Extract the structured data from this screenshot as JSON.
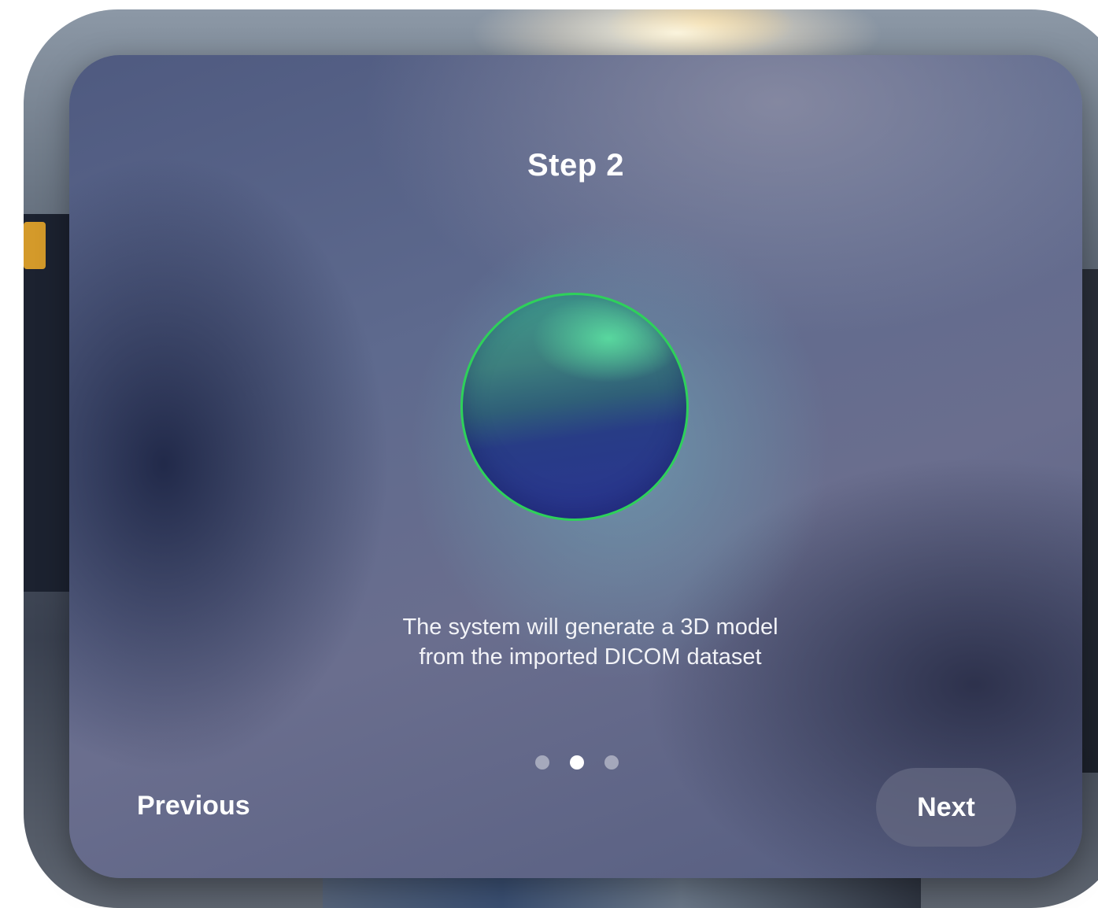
{
  "dialog": {
    "title": "Step 2",
    "description": "The system will generate a 3D model from the imported DICOM dataset",
    "pagination": {
      "total": 3,
      "current": 2
    }
  },
  "footer": {
    "previous_label": "Previous",
    "next_label": "Next"
  },
  "colors": {
    "globe_outline": "#2ed15a",
    "dot_active": "#ffffff",
    "dot_inactive": "#a9adbb"
  },
  "icons": {
    "hero": "globe-icon"
  }
}
